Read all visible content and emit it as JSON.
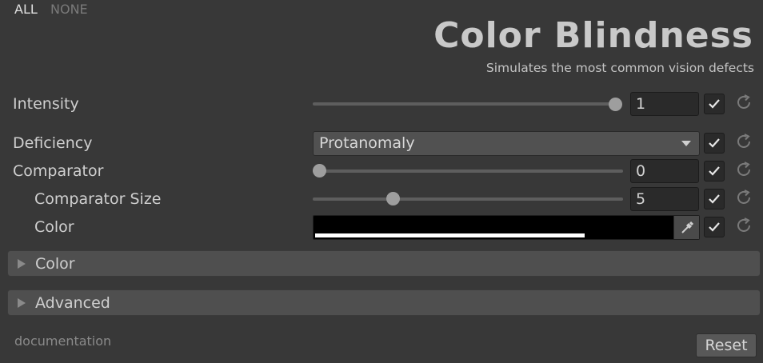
{
  "toolbar": {
    "all_label": "ALL",
    "none_label": "NONE"
  },
  "header": {
    "title": "Color Blindness",
    "subtitle": "Simulates the most common vision defects"
  },
  "properties": {
    "intensity": {
      "label": "Intensity",
      "value": "1",
      "slider_fraction": 1.0,
      "enabled": true
    },
    "deficiency": {
      "label": "Deficiency",
      "selected": "Protanomaly",
      "enabled": true
    },
    "comparator": {
      "label": "Comparator",
      "value": "0",
      "slider_fraction": 0.0,
      "enabled": true
    },
    "comparator_size": {
      "label": "Comparator Size",
      "value": "5",
      "slider_fraction": 0.25,
      "enabled": true
    },
    "color": {
      "label": "Color",
      "hex": "#000000",
      "alpha": 1.0,
      "enabled": true
    }
  },
  "sections": {
    "color_label": "Color",
    "advanced_label": "Advanced"
  },
  "footer": {
    "documentation_label": "documentation",
    "reset_label": "Reset"
  },
  "icons": {
    "check": "checkmark-icon",
    "reset": "reset-arrow-icon",
    "picker": "eyedropper-icon",
    "foldout": "triangle-right-icon",
    "dropdown": "chevron-down-icon"
  },
  "colors": {
    "background": "#383838",
    "field": "#2a2a2a",
    "foldout": "#4f4f4f",
    "thumb": "#9e9e9e"
  }
}
